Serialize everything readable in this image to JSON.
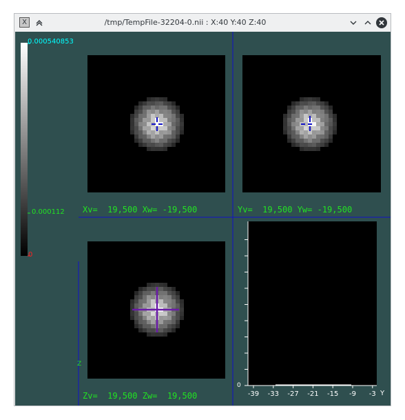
{
  "window": {
    "title": "/tmp/TempFile-32204-0.nii : X:40 Y:40 Z:40",
    "app_icon": "x-app-icon",
    "buttons": [
      "keep-above-icon",
      "minimize-icon",
      "maximize-icon",
      "close-icon"
    ]
  },
  "colorbar": {
    "max_label": "0.000540853",
    "mid_label": "0.000112",
    "min_label": "0",
    "colors": {
      "max": "#00ffff",
      "mid": "#22e322",
      "min": "#ff2020"
    }
  },
  "views": {
    "x_view": {
      "coords": "Xv=  19,500 Xw= -19,500"
    },
    "y_view": {
      "coords": "Yv=  19,500 Yw= -19,500"
    },
    "z_view": {
      "coords": "Zv=  19,500 Zw=  19,500",
      "side_mark": "Z"
    }
  },
  "profile": {
    "x_ticks": [
      "-39",
      "-33",
      "-27",
      "-21",
      "-15",
      "-9",
      "-3"
    ],
    "y_zero": "0",
    "axis_label": "Y"
  },
  "colors": {
    "background": "#2f4f4f",
    "crosshair": "#1010c8",
    "coord_text": "#22e322"
  }
}
